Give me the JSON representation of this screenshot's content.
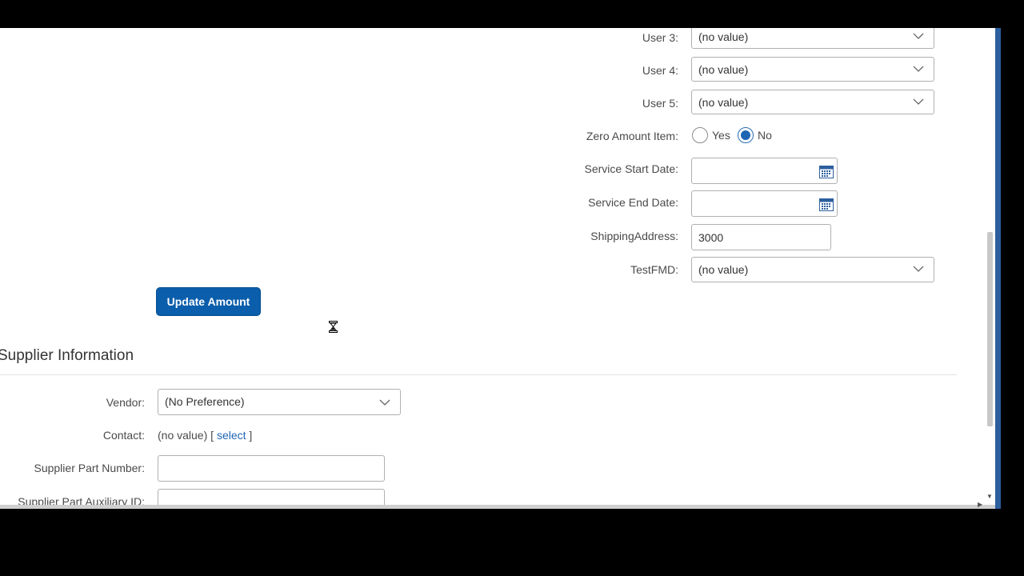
{
  "custom_fields": [
    {
      "label": "User 3:",
      "value": "(no value)"
    },
    {
      "label": "User 4:",
      "value": "(no value)"
    },
    {
      "label": "User 5:",
      "value": "(no value)"
    }
  ],
  "zero_amount_item": {
    "label": "Zero Amount Item:",
    "yes_label": "Yes",
    "no_label": "No",
    "selected": "No"
  },
  "service_start_date": {
    "label": "Service Start Date:",
    "value": ""
  },
  "service_end_date": {
    "label": "Service End Date:",
    "value": ""
  },
  "shipping_address": {
    "label": "ShippingAddress:",
    "value": "3000"
  },
  "test_fmd": {
    "label": "TestFMD:",
    "value": "(no value)"
  },
  "update_amount_button": "Update Amount",
  "supplier_section": {
    "title": "Supplier Information",
    "vendor": {
      "label": "Vendor:",
      "value": "(No Preference)"
    },
    "contact": {
      "label": "Contact:",
      "value": "(no value) [",
      "link": "select",
      "suffix": "]"
    },
    "supplier_part_number": {
      "label": "Supplier Part Number:",
      "value": ""
    },
    "supplier_part_aux_id": {
      "label": "Supplier Part Auxiliary ID:",
      "value": ""
    }
  },
  "colors": {
    "primary_button": "#0a5eab",
    "radio_selected": "#1f65b3",
    "link": "#1f65b3",
    "calendar_icon": "#2c5f9e"
  },
  "icons": [
    "chevron-down-icon",
    "calendar-icon",
    "hourglass-cursor-icon"
  ]
}
